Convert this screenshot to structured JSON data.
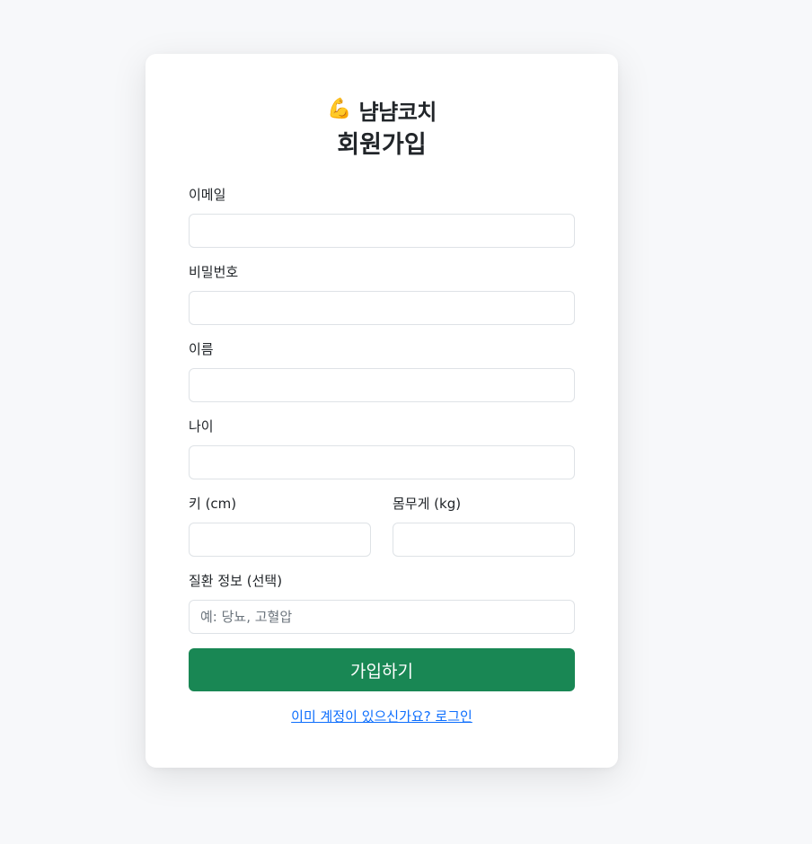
{
  "brand": {
    "icon": "💪",
    "icon_name": "flexed-biceps-icon",
    "name": "냠냠코치"
  },
  "page": {
    "title": "회원가입"
  },
  "form": {
    "email": {
      "label": "이메일",
      "value": "",
      "placeholder": ""
    },
    "password": {
      "label": "비밀번호",
      "value": "",
      "placeholder": ""
    },
    "name": {
      "label": "이름",
      "value": "",
      "placeholder": ""
    },
    "age": {
      "label": "나이",
      "value": "",
      "placeholder": ""
    },
    "height": {
      "label": "키 (cm)",
      "value": "",
      "placeholder": ""
    },
    "weight": {
      "label": "몸무게 (kg)",
      "value": "",
      "placeholder": ""
    },
    "disease": {
      "label": "질환 정보 (선택)",
      "value": "",
      "placeholder": "예: 당뇨, 고혈압"
    },
    "submit_label": "가입하기"
  },
  "footer": {
    "login_link": "이미 계정이 있으신가요? 로그인"
  },
  "colors": {
    "background": "#f7f8fa",
    "primary_button": "#198754",
    "link": "#0d6efd"
  }
}
